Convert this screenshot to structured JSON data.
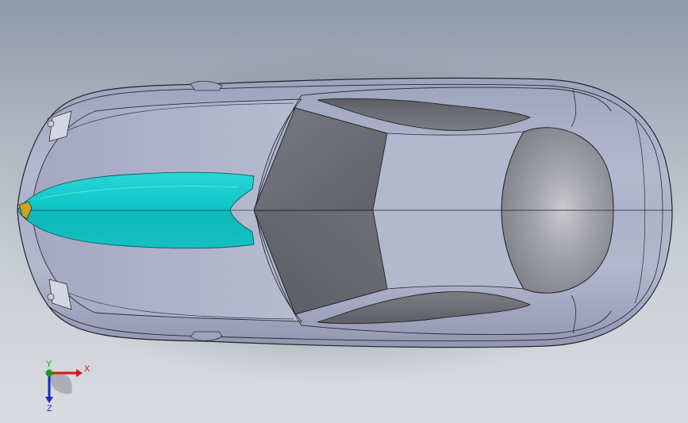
{
  "viewport": {
    "background_top": "#8f9aa9",
    "background_bottom": "#d9dce0",
    "accent_color": "#14c8c8"
  },
  "model": {
    "body_color": "#a9adc6",
    "glass_color": "#6f7078",
    "stripe_color": "#14c8c8",
    "badge_color": "#c9a227"
  },
  "triad": {
    "x_label": "X",
    "y_label": "Y",
    "z_label": "Z",
    "x_color": "#d01818",
    "y_color": "#18a018",
    "z_color": "#1828c8"
  }
}
